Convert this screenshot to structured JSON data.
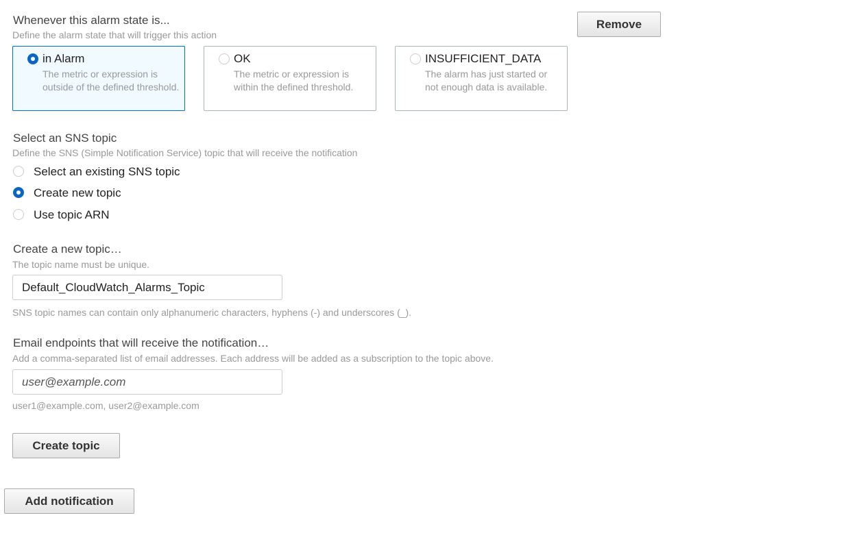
{
  "alarm_state": {
    "heading": "Whenever this alarm state is...",
    "description": "Define the alarm state that will trigger this action",
    "options": [
      {
        "label": "in Alarm",
        "description": "The metric or expression is outside of the defined threshold.",
        "selected": true
      },
      {
        "label": "OK",
        "description": "The metric or expression is within the defined threshold.",
        "selected": false
      },
      {
        "label": "INSUFFICIENT_DATA",
        "description": "The alarm has just started or not enough data is available.",
        "selected": false
      }
    ]
  },
  "remove_label": "Remove",
  "sns": {
    "heading": "Select an SNS topic",
    "description": "Define the SNS (Simple Notification Service) topic that will receive the notification",
    "options": [
      {
        "label": "Select an existing SNS topic",
        "selected": false
      },
      {
        "label": "Create new topic",
        "selected": true
      },
      {
        "label": "Use topic ARN",
        "selected": false
      }
    ]
  },
  "new_topic": {
    "heading": "Create a new topic…",
    "description": "The topic name must be unique.",
    "value": "Default_CloudWatch_Alarms_Topic",
    "help": "SNS topic names can contain only alphanumeric characters, hyphens (-) and underscores (_)."
  },
  "email": {
    "heading": "Email endpoints that will receive the notification…",
    "description": "Add a comma-separated list of email addresses. Each address will be added as a subscription to the topic above.",
    "placeholder": "user@example.com",
    "help": "user1@example.com, user2@example.com"
  },
  "create_topic_label": "Create topic",
  "add_notification_label": "Add notification",
  "colors": {
    "accent": "#0a66c2",
    "selected_card_bg": "#f1faff"
  }
}
